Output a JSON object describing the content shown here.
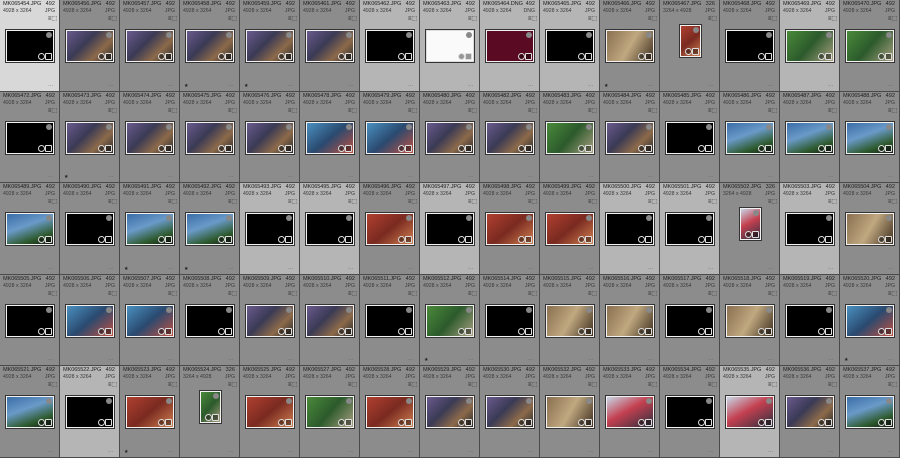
{
  "grid": {
    "rows": [
      {
        "cells": [
          {
            "filename": "MK065454.JPG",
            "size": "492",
            "dims": "4928 x 3264",
            "ext": "JPG",
            "bg": "c-sel",
            "thumb": "black",
            "stars": ""
          },
          {
            "filename": "MK065456.JPG",
            "size": "492",
            "dims": "4928 x 3264",
            "ext": "JPG",
            "bg": "c-gray",
            "thumb": "photo",
            "stars": ""
          },
          {
            "filename": "MK065457.JPG",
            "size": "492",
            "dims": "4928 x 3264",
            "ext": "JPG",
            "bg": "c-gray",
            "thumb": "photo",
            "stars": ""
          },
          {
            "filename": "MK065458.JPG",
            "size": "492",
            "dims": "4928 x 3264",
            "ext": "JPG",
            "bg": "c-gray",
            "thumb": "photo",
            "stars": "★"
          },
          {
            "filename": "MK065459.JPG",
            "size": "492",
            "dims": "4928 x 3264",
            "ext": "JPG",
            "bg": "c-gray",
            "thumb": "photo",
            "stars": "★"
          },
          {
            "filename": "MK065461.JPG",
            "size": "492",
            "dims": "4928 x 3264",
            "ext": "JPG",
            "bg": "c-gray",
            "thumb": "photo",
            "stars": ""
          },
          {
            "filename": "MK065462.JPG",
            "size": "492",
            "dims": "4928 x 3264",
            "ext": "JPG",
            "bg": "c-light",
            "thumb": "black",
            "stars": ""
          },
          {
            "filename": "MK065463.JPG",
            "size": "492",
            "dims": "4928 x 3264",
            "ext": "JPG",
            "bg": "c-light",
            "thumb": "white",
            "stars": ""
          },
          {
            "filename": "MK065464.DNG",
            "size": "492",
            "dims": "4928 x 3264",
            "ext": "DNG",
            "bg": "c-light",
            "thumb": "dark",
            "stars": ""
          },
          {
            "filename": "MK065465.JPG",
            "size": "492",
            "dims": "4928 x 3264",
            "ext": "JPG",
            "bg": "c-light",
            "thumb": "black",
            "stars": ""
          },
          {
            "filename": "MK065466.JPG",
            "size": "492",
            "dims": "4928 x 3264",
            "ext": "JPG",
            "bg": "c-gray",
            "thumb": "photo6",
            "stars": "★"
          },
          {
            "filename": "MK065467.JPG",
            "size": "326",
            "dims": "3264 x 4928",
            "ext": "JPG",
            "bg": "c-gray",
            "thumb": "photo3",
            "stars": "",
            "portrait": true
          },
          {
            "filename": "MK065468.JPG",
            "size": "492",
            "dims": "4928 x 3264",
            "ext": "JPG",
            "bg": "c-gray",
            "thumb": "black",
            "stars": ""
          },
          {
            "filename": "MK065469.JPG",
            "size": "492",
            "dims": "4928 x 3264",
            "ext": "JPG",
            "bg": "c-light",
            "thumb": "photo5",
            "stars": ""
          },
          {
            "filename": "MK065470.JPG",
            "size": "492",
            "dims": "4928 x 3264",
            "ext": "JPG",
            "bg": "c-gray",
            "thumb": "photo5",
            "stars": ""
          }
        ]
      },
      {
        "cells": [
          {
            "filename": "MK065472.JPG",
            "size": "492",
            "dims": "4928 x 3264",
            "ext": "JPG",
            "bg": "c-gray",
            "thumb": "black",
            "stars": ""
          },
          {
            "filename": "MK065473.JPG",
            "size": "492",
            "dims": "4928 x 3264",
            "ext": "JPG",
            "bg": "c-gray",
            "thumb": "photo",
            "stars": "★"
          },
          {
            "filename": "MK065474.JPG",
            "size": "492",
            "dims": "4928 x 3264",
            "ext": "JPG",
            "bg": "c-gray",
            "thumb": "photo",
            "stars": ""
          },
          {
            "filename": "MK065475.JPG",
            "size": "492",
            "dims": "4928 x 3264",
            "ext": "JPG",
            "bg": "c-gray",
            "thumb": "photo",
            "stars": ""
          },
          {
            "filename": "MK065476.JPG",
            "size": "492",
            "dims": "4928 x 3264",
            "ext": "JPG",
            "bg": "c-gray",
            "thumb": "photo",
            "stars": ""
          },
          {
            "filename": "MK065478.JPG",
            "size": "492",
            "dims": "4928 x 3264",
            "ext": "JPG",
            "bg": "c-gray",
            "thumb": "photo7",
            "stars": ""
          },
          {
            "filename": "MK065479.JPG",
            "size": "492",
            "dims": "4928 x 3264",
            "ext": "JPG",
            "bg": "c-gray",
            "thumb": "photo7",
            "stars": ""
          },
          {
            "filename": "MK065480.JPG",
            "size": "492",
            "dims": "4928 x 3264",
            "ext": "JPG",
            "bg": "c-gray",
            "thumb": "photo",
            "stars": ""
          },
          {
            "filename": "MK065482.JPG",
            "size": "492",
            "dims": "4928 x 3264",
            "ext": "JPG",
            "bg": "c-gray",
            "thumb": "photo",
            "stars": ""
          },
          {
            "filename": "MK065483.JPG",
            "size": "492",
            "dims": "4928 x 3264",
            "ext": "JPG",
            "bg": "c-gray",
            "thumb": "photo5",
            "stars": ""
          },
          {
            "filename": "MK065484.JPG",
            "size": "492",
            "dims": "4928 x 3264",
            "ext": "JPG",
            "bg": "c-gray",
            "thumb": "photo",
            "stars": ""
          },
          {
            "filename": "MK065485.JPG",
            "size": "492",
            "dims": "4928 x 3264",
            "ext": "JPG",
            "bg": "c-gray",
            "thumb": "black",
            "stars": ""
          },
          {
            "filename": "MK065486.JPG",
            "size": "492",
            "dims": "4928 x 3264",
            "ext": "JPG",
            "bg": "c-gray",
            "thumb": "photo2",
            "stars": ""
          },
          {
            "filename": "MK065487.JPG",
            "size": "492",
            "dims": "4928 x 3264",
            "ext": "JPG",
            "bg": "c-gray",
            "thumb": "photo2",
            "stars": ""
          },
          {
            "filename": "MK065488.JPG",
            "size": "492",
            "dims": "4928 x 3264",
            "ext": "JPG",
            "bg": "c-gray",
            "thumb": "photo2",
            "stars": ""
          }
        ]
      },
      {
        "cells": [
          {
            "filename": "MK065489.JPG",
            "size": "492",
            "dims": "4928 x 3264",
            "ext": "JPG",
            "bg": "c-gray",
            "thumb": "photo2",
            "stars": ""
          },
          {
            "filename": "MK065490.JPG",
            "size": "492",
            "dims": "4928 x 3264",
            "ext": "JPG",
            "bg": "c-gray",
            "thumb": "black",
            "stars": ""
          },
          {
            "filename": "MK065491.JPG",
            "size": "492",
            "dims": "4928 x 3264",
            "ext": "JPG",
            "bg": "c-gray",
            "thumb": "photo2",
            "stars": "★"
          },
          {
            "filename": "MK065492.JPG",
            "size": "492",
            "dims": "4928 x 3264",
            "ext": "JPG",
            "bg": "c-gray",
            "thumb": "photo2",
            "stars": "★"
          },
          {
            "filename": "MK065493.JPG",
            "size": "492",
            "dims": "4928 x 3264",
            "ext": "JPG",
            "bg": "c-light",
            "thumb": "black",
            "stars": ""
          },
          {
            "filename": "MK065495.JPG",
            "size": "492",
            "dims": "4928 x 3264",
            "ext": "JPG",
            "bg": "c-light",
            "thumb": "black",
            "stars": ""
          },
          {
            "filename": "MK065496.JPG",
            "size": "492",
            "dims": "4928 x 3264",
            "ext": "JPG",
            "bg": "c-gray",
            "thumb": "photo3",
            "stars": ""
          },
          {
            "filename": "MK065497.JPG",
            "size": "492",
            "dims": "4928 x 3264",
            "ext": "JPG",
            "bg": "c-light",
            "thumb": "black",
            "stars": ""
          },
          {
            "filename": "MK065498.JPG",
            "size": "492",
            "dims": "4928 x 3264",
            "ext": "JPG",
            "bg": "c-gray",
            "thumb": "photo3",
            "stars": ""
          },
          {
            "filename": "MK065499.JPG",
            "size": "492",
            "dims": "4928 x 3264",
            "ext": "JPG",
            "bg": "c-gray",
            "thumb": "photo3",
            "stars": ""
          },
          {
            "filename": "MK065500.JPG",
            "size": "492",
            "dims": "4928 x 3264",
            "ext": "JPG",
            "bg": "c-light",
            "thumb": "black",
            "stars": ""
          },
          {
            "filename": "MK065501.JPG",
            "size": "492",
            "dims": "4928 x 3264",
            "ext": "JPG",
            "bg": "c-light",
            "thumb": "black",
            "stars": ""
          },
          {
            "filename": "MK065502.JPG",
            "size": "326",
            "dims": "3264 x 4928",
            "ext": "JPG",
            "bg": "c-gray",
            "thumb": "photo4",
            "stars": "",
            "portrait": true
          },
          {
            "filename": "MK065503.JPG",
            "size": "492",
            "dims": "4928 x 3264",
            "ext": "JPG",
            "bg": "c-light",
            "thumb": "black",
            "stars": ""
          },
          {
            "filename": "MK065504.JPG",
            "size": "492",
            "dims": "4928 x 3264",
            "ext": "JPG",
            "bg": "c-gray",
            "thumb": "photo6",
            "stars": ""
          }
        ]
      },
      {
        "cells": [
          {
            "filename": "MK065505.JPG",
            "size": "492",
            "dims": "4928 x 3264",
            "ext": "JPG",
            "bg": "c-gray",
            "thumb": "black",
            "stars": ""
          },
          {
            "filename": "MK065506.JPG",
            "size": "492",
            "dims": "4928 x 3264",
            "ext": "JPG",
            "bg": "c-gray",
            "thumb": "photo7",
            "stars": ""
          },
          {
            "filename": "MK065507.JPG",
            "size": "492",
            "dims": "4928 x 3264",
            "ext": "JPG",
            "bg": "c-gray",
            "thumb": "photo7",
            "stars": ""
          },
          {
            "filename": "MK065508.JPG",
            "size": "492",
            "dims": "4928 x 3264",
            "ext": "JPG",
            "bg": "c-gray",
            "thumb": "black",
            "stars": ""
          },
          {
            "filename": "MK065509.JPG",
            "size": "492",
            "dims": "4928 x 3264",
            "ext": "JPG",
            "bg": "c-gray",
            "thumb": "photo",
            "stars": ""
          },
          {
            "filename": "MK065510.JPG",
            "size": "492",
            "dims": "4928 x 3264",
            "ext": "JPG",
            "bg": "c-gray",
            "thumb": "photo",
            "stars": ""
          },
          {
            "filename": "MK065511.JPG",
            "size": "492",
            "dims": "4928 x 3264",
            "ext": "JPG",
            "bg": "c-gray",
            "thumb": "black",
            "stars": ""
          },
          {
            "filename": "MK065512.JPG",
            "size": "492",
            "dims": "4928 x 3264",
            "ext": "JPG",
            "bg": "c-gray",
            "thumb": "photo5",
            "stars": "★"
          },
          {
            "filename": "MK065514.JPG",
            "size": "492",
            "dims": "4928 x 3264",
            "ext": "JPG",
            "bg": "c-gray",
            "thumb": "black",
            "stars": ""
          },
          {
            "filename": "MK065515.JPG",
            "size": "492",
            "dims": "4928 x 3264",
            "ext": "JPG",
            "bg": "c-gray",
            "thumb": "photo6",
            "stars": ""
          },
          {
            "filename": "MK065516.JPG",
            "size": "492",
            "dims": "4928 x 3264",
            "ext": "JPG",
            "bg": "c-gray",
            "thumb": "photo6",
            "stars": ""
          },
          {
            "filename": "MK065517.JPG",
            "size": "492",
            "dims": "4928 x 3264",
            "ext": "JPG",
            "bg": "c-gray",
            "thumb": "black",
            "stars": ""
          },
          {
            "filename": "MK065518.JPG",
            "size": "492",
            "dims": "4928 x 3264",
            "ext": "JPG",
            "bg": "c-gray",
            "thumb": "photo6",
            "stars": ""
          },
          {
            "filename": "MK065519.JPG",
            "size": "492",
            "dims": "4928 x 3264",
            "ext": "JPG",
            "bg": "c-gray",
            "thumb": "black",
            "stars": ""
          },
          {
            "filename": "MK065520.JPG",
            "size": "492",
            "dims": "4928 x 3264",
            "ext": "JPG",
            "bg": "c-gray",
            "thumb": "photo7",
            "stars": "★"
          }
        ]
      },
      {
        "cells": [
          {
            "filename": "MK065521.JPG",
            "size": "492",
            "dims": "4928 x 3264",
            "ext": "JPG",
            "bg": "c-gray",
            "thumb": "photo2",
            "stars": ""
          },
          {
            "filename": "MK065522.JPG",
            "size": "492",
            "dims": "4928 x 3264",
            "ext": "JPG",
            "bg": "c-light",
            "thumb": "black",
            "stars": ""
          },
          {
            "filename": "MK065523.JPG",
            "size": "492",
            "dims": "4928 x 3264",
            "ext": "JPG",
            "bg": "c-gray",
            "thumb": "photo3",
            "stars": "★"
          },
          {
            "filename": "MK065524.JPG",
            "size": "326",
            "dims": "3264 x 4928",
            "ext": "JPG",
            "bg": "c-gray",
            "thumb": "photo5",
            "stars": "",
            "portrait": true
          },
          {
            "filename": "MK065525.JPG",
            "size": "492",
            "dims": "4928 x 3264",
            "ext": "JPG",
            "bg": "c-gray",
            "thumb": "photo3",
            "stars": ""
          },
          {
            "filename": "MK065527.JPG",
            "size": "492",
            "dims": "4928 x 3264",
            "ext": "JPG",
            "bg": "c-gray",
            "thumb": "photo5",
            "stars": ""
          },
          {
            "filename": "MK065528.JPG",
            "size": "492",
            "dims": "4928 x 3264",
            "ext": "JPG",
            "bg": "c-gray",
            "thumb": "photo3",
            "stars": ""
          },
          {
            "filename": "MK065529.JPG",
            "size": "492",
            "dims": "4928 x 3264",
            "ext": "JPG",
            "bg": "c-gray",
            "thumb": "photo",
            "stars": ""
          },
          {
            "filename": "MK065530.JPG",
            "size": "492",
            "dims": "4928 x 3264",
            "ext": "JPG",
            "bg": "c-gray",
            "thumb": "photo",
            "stars": ""
          },
          {
            "filename": "MK065532.JPG",
            "size": "492",
            "dims": "4928 x 3264",
            "ext": "JPG",
            "bg": "c-gray",
            "thumb": "photo6",
            "stars": ""
          },
          {
            "filename": "MK065533.JPG",
            "size": "492",
            "dims": "4928 x 3264",
            "ext": "JPG",
            "bg": "c-gray",
            "thumb": "photo4",
            "stars": ""
          },
          {
            "filename": "MK065534.JPG",
            "size": "492",
            "dims": "4928 x 3264",
            "ext": "JPG",
            "bg": "c-gray",
            "thumb": "black",
            "stars": ""
          },
          {
            "filename": "MK065535.JPG",
            "size": "492",
            "dims": "4928 x 3264",
            "ext": "JPG",
            "bg": "c-light",
            "thumb": "photo4",
            "stars": ""
          },
          {
            "filename": "MK065536.JPG",
            "size": "492",
            "dims": "4928 x 3264",
            "ext": "JPG",
            "bg": "c-gray",
            "thumb": "photo",
            "stars": ""
          },
          {
            "filename": "MK065537.JPG",
            "size": "492",
            "dims": "4928 x 3264",
            "ext": "JPG",
            "bg": "c-gray",
            "thumb": "photo2",
            "stars": ""
          }
        ]
      }
    ]
  },
  "icons": {
    "badge": "metadata-badge-icon",
    "crop": "crop-badge-icon",
    "edit": "develop-badge-icon"
  },
  "colors": {
    "cell_gray": "#8c8c8c",
    "cell_light": "#b5b5b5",
    "cell_selected": "#d8d8d8",
    "background": "#5a5a5a"
  }
}
